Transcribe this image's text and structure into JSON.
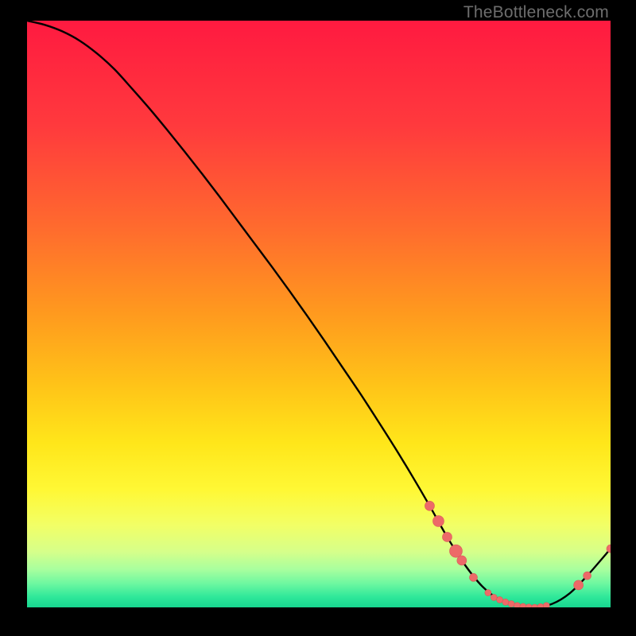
{
  "watermark": "TheBottleneck.com",
  "colors": {
    "curve": "#000000",
    "marker_fill": "#ed6a68",
    "marker_stroke": "#d85a58",
    "gradient_stops": [
      {
        "offset": 0.0,
        "color": "#ff1a40"
      },
      {
        "offset": 0.18,
        "color": "#ff3a3d"
      },
      {
        "offset": 0.35,
        "color": "#ff6a2e"
      },
      {
        "offset": 0.5,
        "color": "#ff9a1e"
      },
      {
        "offset": 0.62,
        "color": "#ffc318"
      },
      {
        "offset": 0.72,
        "color": "#ffe61a"
      },
      {
        "offset": 0.8,
        "color": "#fff835"
      },
      {
        "offset": 0.86,
        "color": "#f2ff66"
      },
      {
        "offset": 0.905,
        "color": "#d6ff8a"
      },
      {
        "offset": 0.935,
        "color": "#a9ff9e"
      },
      {
        "offset": 0.96,
        "color": "#6cf7a0"
      },
      {
        "offset": 0.982,
        "color": "#2fe89a"
      },
      {
        "offset": 1.0,
        "color": "#17d68f"
      }
    ]
  },
  "chart_data": {
    "type": "line",
    "title": "",
    "xlabel": "",
    "ylabel": "",
    "xlim": [
      0,
      100
    ],
    "ylim": [
      0,
      100
    ],
    "x": [
      0,
      3,
      6,
      9,
      12,
      15,
      18,
      21,
      24,
      27,
      30,
      33,
      36,
      39,
      42,
      45,
      48,
      51,
      54,
      57,
      60,
      63,
      66,
      69,
      72,
      75,
      78,
      81,
      84,
      87,
      90,
      93,
      96,
      100
    ],
    "y": [
      100,
      99.3,
      98.2,
      96.6,
      94.4,
      91.7,
      88.4,
      85.0,
      81.4,
      77.7,
      73.9,
      70.0,
      66.0,
      62.0,
      58.0,
      53.9,
      49.7,
      45.4,
      41.0,
      36.6,
      32.0,
      27.3,
      22.4,
      17.3,
      12.0,
      7.3,
      3.6,
      1.3,
      0.3,
      0.0,
      0.6,
      2.4,
      5.4,
      10.0
    ],
    "markers": [
      {
        "x": 69.0,
        "y": 17.3,
        "r": 6
      },
      {
        "x": 70.5,
        "y": 14.7,
        "r": 7
      },
      {
        "x": 72.0,
        "y": 12.0,
        "r": 6
      },
      {
        "x": 73.5,
        "y": 9.6,
        "r": 8
      },
      {
        "x": 74.5,
        "y": 8.0,
        "r": 6
      },
      {
        "x": 76.5,
        "y": 5.1,
        "r": 5
      },
      {
        "x": 79.0,
        "y": 2.5,
        "r": 4
      },
      {
        "x": 80.0,
        "y": 1.7,
        "r": 4
      },
      {
        "x": 81.0,
        "y": 1.3,
        "r": 4
      },
      {
        "x": 82.0,
        "y": 0.9,
        "r": 4
      },
      {
        "x": 83.0,
        "y": 0.6,
        "r": 4
      },
      {
        "x": 84.0,
        "y": 0.3,
        "r": 4
      },
      {
        "x": 85.0,
        "y": 0.15,
        "r": 4
      },
      {
        "x": 86.0,
        "y": 0.05,
        "r": 4
      },
      {
        "x": 87.0,
        "y": 0.0,
        "r": 4
      },
      {
        "x": 88.0,
        "y": 0.1,
        "r": 4
      },
      {
        "x": 89.0,
        "y": 0.3,
        "r": 4
      },
      {
        "x": 94.5,
        "y": 3.8,
        "r": 6
      },
      {
        "x": 96.0,
        "y": 5.4,
        "r": 5
      },
      {
        "x": 100.0,
        "y": 10.0,
        "r": 5
      }
    ]
  }
}
